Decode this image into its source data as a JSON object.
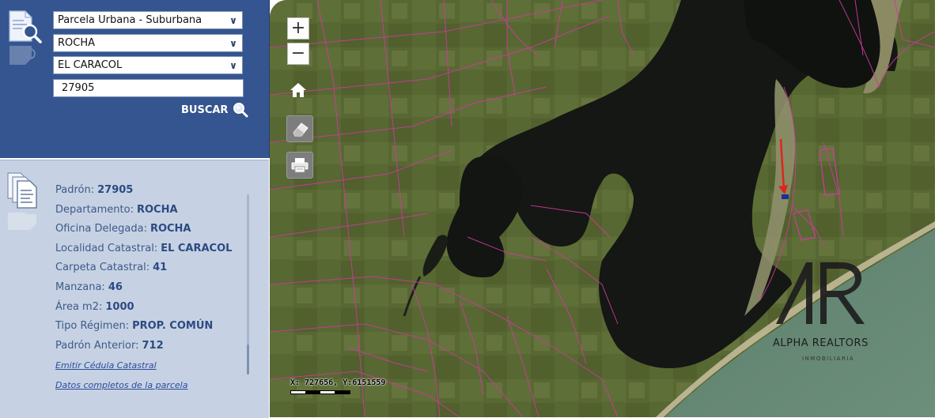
{
  "search": {
    "type_select": "Parcela Urbana - Suburbana",
    "department_select": "ROCHA",
    "locality_select": "EL CARACOL",
    "padron_input": "27905",
    "search_label": "BUSCAR"
  },
  "info": {
    "rows": [
      {
        "label": "Padrón:",
        "value": "27905"
      },
      {
        "label": "Departamento:",
        "value": "ROCHA"
      },
      {
        "label": "Oficina Delegada:",
        "value": "ROCHA"
      },
      {
        "label": "Localidad Catastral:",
        "value": "EL CARACOL"
      },
      {
        "label": "Carpeta Catastral:",
        "value": "41"
      },
      {
        "label": "Manzana:",
        "value": "46"
      },
      {
        "label": "Área m2:",
        "value": "1000"
      },
      {
        "label": "Tipo Régimen:",
        "value": "PROP. COMÚN"
      },
      {
        "label": "Padrón Anterior:",
        "value": "712"
      }
    ],
    "link_cedula": "Emitir Cédula Catastral",
    "link_datos": "Datos completos de la parcela"
  },
  "map": {
    "zoom_in": "+",
    "zoom_out": "−",
    "coordinates": "X: 727656, Y:6151559",
    "watermark_name": "ALPHA REALTORS",
    "watermark_sub": "INMOBILIARIA",
    "parcel_line_color": "#d0399f",
    "marker_color": "#e0241b",
    "parcel_highlight_color": "#1c2f9a"
  },
  "icons": {
    "search_panel": "document-search-icon",
    "info_panel": "documents-stack-icon",
    "search_button": "magnifier-icon",
    "home": "home-icon",
    "eraser": "eraser-icon",
    "print": "printer-icon"
  }
}
